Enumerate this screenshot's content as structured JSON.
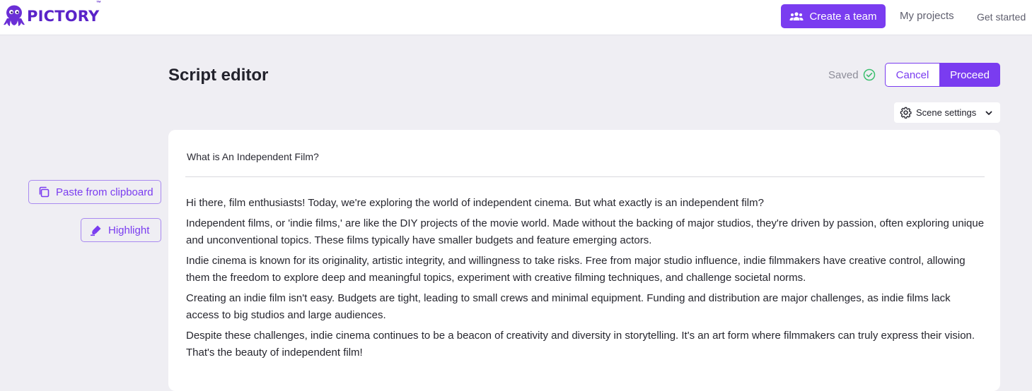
{
  "header": {
    "logo_text": "PICTORY",
    "logo_tm": "™",
    "create_team_label": "Create a team",
    "my_projects_label": "My projects",
    "get_started_label": "Get started"
  },
  "editor_header": {
    "title": "Script editor",
    "saved_label": "Saved",
    "cancel_label": "Cancel",
    "proceed_label": "Proceed",
    "scene_settings_label": "Scene settings"
  },
  "sidebar": {
    "paste_label": "Paste from clipboard",
    "highlight_label": "Highlight"
  },
  "script": {
    "heading": "What is An Independent Film?",
    "paragraphs": [
      "Hi there, film enthusiasts! Today, we're exploring the world of independent cinema. But what exactly is an independent film?",
      "Independent films, or 'indie films,' are like the DIY projects of the movie world. Made without the backing of major studios, they're driven by passion, often exploring unique and unconventional topics. These films typically have smaller budgets and feature emerging actors.",
      "Indie cinema is known for its originality, artistic integrity, and willingness to take risks. Free from major studio influence, indie filmmakers have creative control, allowing them the freedom to explore deep and meaningful topics, experiment with creative filming techniques, and challenge societal norms.",
      "Creating an indie film isn't easy. Budgets are tight, leading to small crews and minimal equipment. Funding and distribution are major challenges, as indie films lack access to big studios and large audiences.",
      "Despite these challenges, indie cinema continues to be a beacon of creativity and diversity in storytelling. It's an art form where filmmakers can truly express their vision. That's the beauty of independent film!"
    ]
  },
  "icons": {
    "logo": "octopus-logo-icon",
    "team": "team-icon",
    "saved": "check-circle-icon",
    "settings": "gear-icon",
    "dropdown": "chevron-down-icon",
    "paste": "copy-icon",
    "highlight": "highlighter-icon"
  },
  "colors": {
    "accent": "#7a3cf0",
    "brand": "#5a23c8",
    "saved_check": "#3cbf6e",
    "background": "#efeef3"
  }
}
